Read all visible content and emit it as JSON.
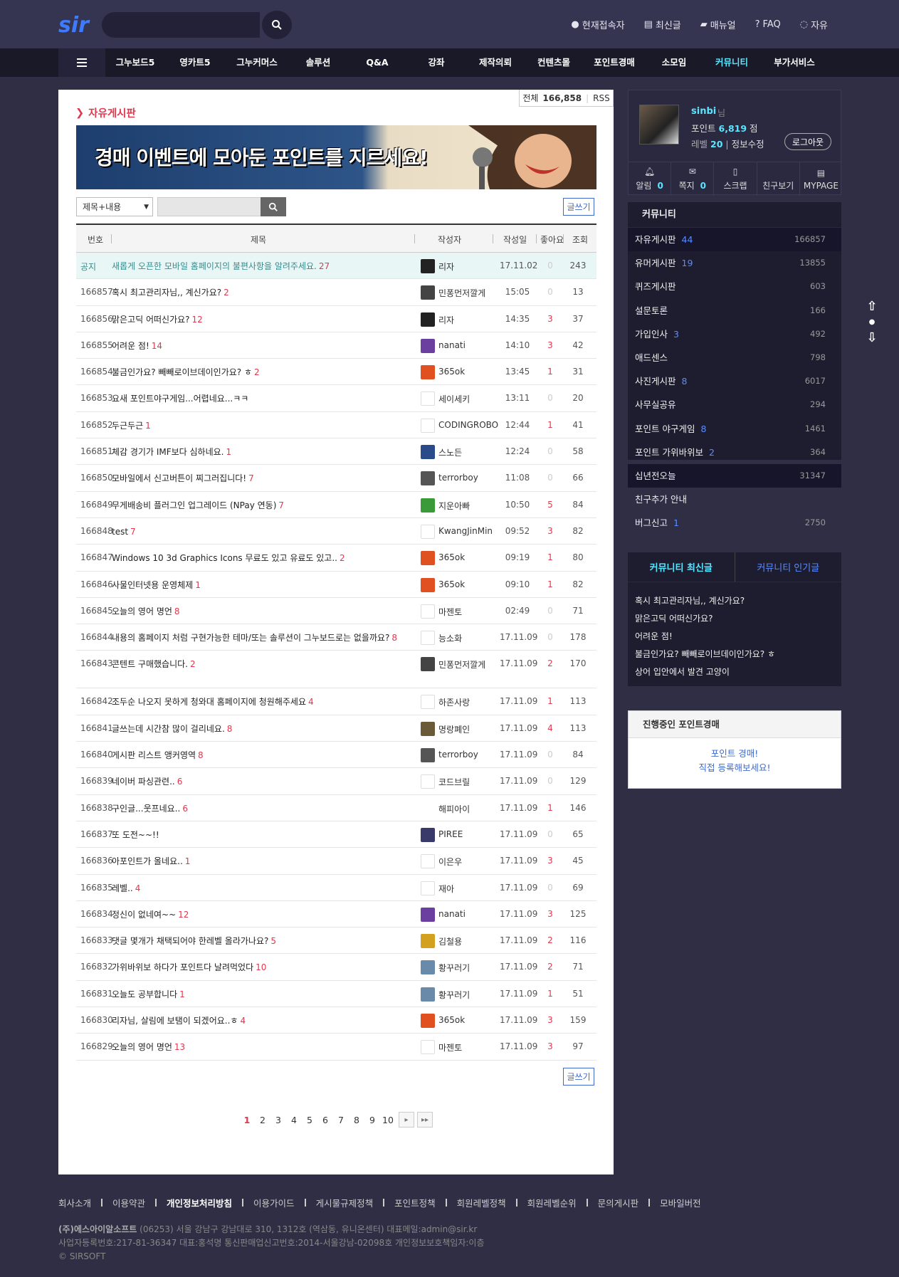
{
  "top_links": [
    "현재접속자",
    "최신글",
    "매뉴얼",
    "FAQ",
    "자유"
  ],
  "nav": [
    "그누보드5",
    "영카트5",
    "그누커머스",
    "솔루션",
    "Q&A",
    "강좌",
    "제작의뢰",
    "컨텐츠몰",
    "포인트경매",
    "소모임",
    "커뮤니티",
    "부가서비스"
  ],
  "board": {
    "total_label": "전체",
    "total": "166,858",
    "rss": "RSS",
    "title": "자유게시판",
    "banner_text": "경매 이벤트에 모아둔 포인트를 지르세요!",
    "search_field": "제목+내용",
    "write": "글쓰기"
  },
  "columns": {
    "num": "번호",
    "subject": "제목",
    "writer": "작성자",
    "date": "작성일",
    "good": "좋아요",
    "hit": "조회"
  },
  "rows": [
    {
      "num": "공지",
      "subject": "새롭게 오픈한 모바일 홈페이지의 불편사항을 알려주세요.",
      "cmt": "27",
      "name": "리자",
      "date": "17.11.02",
      "good": "0",
      "hit": "243"
    },
    {
      "num": "166857",
      "subject": "혹시 최고관리자님,, 계신가요?",
      "cmt": "2",
      "name": "민퐁먼저깔게",
      "date": "15:05",
      "good": "0",
      "hit": "13"
    },
    {
      "num": "166856",
      "subject": "맑은고딕 어떠신가요?",
      "cmt": "12",
      "name": "리자",
      "date": "14:35",
      "good": "3",
      "hit": "37"
    },
    {
      "num": "166855",
      "subject": "어려운 점!",
      "cmt": "14",
      "name": "nanati",
      "date": "14:10",
      "good": "3",
      "hit": "42"
    },
    {
      "num": "166854",
      "subject": "불금인가요? 빼빼로이브데이인가요? ㅎ",
      "cmt": "2",
      "name": "365ok",
      "date": "13:45",
      "good": "1",
      "hit": "31"
    },
    {
      "num": "166853",
      "subject": "요새 포인트야구게임...어렵네요...ㅋㅋ",
      "cmt": "",
      "name": "세이세키",
      "date": "13:11",
      "good": "0",
      "hit": "20"
    },
    {
      "num": "166852",
      "subject": "두근두근",
      "cmt": "1",
      "name": "CODINGROBO",
      "date": "12:44",
      "good": "1",
      "hit": "41"
    },
    {
      "num": "166851",
      "subject": "체감 경기가 IMF보다 심하네요.",
      "cmt": "1",
      "name": "스노든",
      "date": "12:24",
      "good": "0",
      "hit": "58"
    },
    {
      "num": "166850",
      "subject": "모바일에서 신고버튼이 찌그러집니다!",
      "cmt": "7",
      "name": "terrorboy",
      "date": "11:08",
      "good": "0",
      "hit": "66"
    },
    {
      "num": "166849",
      "subject": "무게배송비 플러그인 업그레이드 (NPay 연동)",
      "cmt": "7",
      "name": "지운아빠",
      "date": "10:50",
      "good": "5",
      "hit": "84"
    },
    {
      "num": "166848",
      "subject": "test",
      "cmt": "7",
      "name": "KwangJinMin",
      "date": "09:52",
      "good": "3",
      "hit": "82"
    },
    {
      "num": "166847",
      "subject": "Windows 10 3d Graphics Icons 무료도 있고 유료도 있고..",
      "cmt": "2",
      "name": "365ok",
      "date": "09:19",
      "good": "1",
      "hit": "80"
    },
    {
      "num": "166846",
      "subject": "사물인터넷용 운영체제",
      "cmt": "1",
      "name": "365ok",
      "date": "09:10",
      "good": "1",
      "hit": "82"
    },
    {
      "num": "166845",
      "subject": "오늘의 영어 명언",
      "cmt": "8",
      "name": "마젠토",
      "date": "02:49",
      "good": "0",
      "hit": "71"
    },
    {
      "num": "166844",
      "subject": "내용의 홈페이지 처럼 구현가능한 테마/또는 솔루션이 그누보드로는 없을까요?",
      "cmt": "8",
      "name": "능소화",
      "date": "17.11.09",
      "good": "0",
      "hit": "178"
    },
    {
      "num": "166843",
      "subject": "콘텐트 구매했습니다.",
      "cmt": "2",
      "name": "민퐁먼저깔게",
      "date": "17.11.09",
      "good": "2",
      "hit": "170"
    },
    {
      "num": "166842",
      "subject": "조두순 나오지 못하게 청와대 홈페이지에 청원해주세요",
      "cmt": "4",
      "name": "하존사랑",
      "date": "17.11.09",
      "good": "1",
      "hit": "113"
    },
    {
      "num": "166841",
      "subject": "글쓰는데 시간참 많이 걸리네요.",
      "cmt": "8",
      "name": "명랑폐인",
      "date": "17.11.09",
      "good": "4",
      "hit": "113"
    },
    {
      "num": "166840",
      "subject": "게시판 리스트 앵커영역",
      "cmt": "8",
      "name": "terrorboy",
      "date": "17.11.09",
      "good": "0",
      "hit": "84"
    },
    {
      "num": "166839",
      "subject": "네이버 파싱관련..",
      "cmt": "6",
      "name": "코드브릴",
      "date": "17.11.09",
      "good": "0",
      "hit": "129"
    },
    {
      "num": "166838",
      "subject": "구인글...웃프네요..",
      "cmt": "6",
      "name": "해피아이",
      "date": "17.11.09",
      "good": "1",
      "hit": "146"
    },
    {
      "num": "166837",
      "subject": "또 도전~~!!",
      "cmt": "",
      "name": "PIREE",
      "date": "17.11.09",
      "good": "0",
      "hit": "65"
    },
    {
      "num": "166836",
      "subject": "아포인트가 올네요..",
      "cmt": "1",
      "name": "이은우",
      "date": "17.11.09",
      "good": "3",
      "hit": "45"
    },
    {
      "num": "166835",
      "subject": "레벨..",
      "cmt": "4",
      "name": "재아",
      "date": "17.11.09",
      "good": "0",
      "hit": "69"
    },
    {
      "num": "166834",
      "subject": "정신이 없네여~~",
      "cmt": "12",
      "name": "nanati",
      "date": "17.11.09",
      "good": "3",
      "hit": "125"
    },
    {
      "num": "166833",
      "subject": "댓글 몇개가 채택되어야 한레벨 올라가나요?",
      "cmt": "5",
      "name": "김철용",
      "date": "17.11.09",
      "good": "2",
      "hit": "116"
    },
    {
      "num": "166832",
      "subject": "가위바위보 하다가 포인트다 날려먹었다",
      "cmt": "10",
      "name": "황꾸러기",
      "date": "17.11.09",
      "good": "2",
      "hit": "71"
    },
    {
      "num": "166831",
      "subject": "오늘도 공부합니다",
      "cmt": "1",
      "name": "황꾸러기",
      "date": "17.11.09",
      "good": "1",
      "hit": "51"
    },
    {
      "num": "166830",
      "subject": "리자님, 살림에 보탬이 되겠어요..ㅎ",
      "cmt": "4",
      "name": "365ok",
      "date": "17.11.09",
      "good": "3",
      "hit": "159"
    },
    {
      "num": "166829",
      "subject": "오늘의 영어 명언",
      "cmt": "13",
      "name": "마젠토",
      "date": "17.11.09",
      "good": "3",
      "hit": "97"
    }
  ],
  "pages": [
    "1",
    "2",
    "3",
    "4",
    "5",
    "6",
    "7",
    "8",
    "9",
    "10"
  ],
  "profile": {
    "name": "sinbi",
    "name_suffix": "님",
    "point_label": "포인트",
    "point": "6,819",
    "point_unit": "점",
    "level_label": "레벨",
    "level": "20",
    "edit": "정보수정",
    "logout": "로그아웃"
  },
  "profile_icons": [
    {
      "label": "알림",
      "count": "0"
    },
    {
      "label": "쪽지",
      "count": "0"
    },
    {
      "label": "스크랩",
      "count": ""
    },
    {
      "label": "친구보기",
      "count": ""
    },
    {
      "label": "MYPAGE",
      "count": ""
    }
  ],
  "community": {
    "title": "커뮤니티",
    "items": [
      {
        "label": "자유게시판",
        "new": "44",
        "total": "166857"
      },
      {
        "label": "유머게시판",
        "new": "19",
        "total": "13855"
      },
      {
        "label": "퀴즈게시판",
        "new": "",
        "total": "603"
      },
      {
        "label": "설문토론",
        "new": "",
        "total": "166"
      },
      {
        "label": "가입인사",
        "new": "3",
        "total": "492"
      },
      {
        "label": "애드센스",
        "new": "",
        "total": "798"
      },
      {
        "label": "사진게시판",
        "new": "8",
        "total": "6017"
      },
      {
        "label": "사무실공유",
        "new": "",
        "total": "294"
      },
      {
        "label": "포인트 야구게임",
        "new": "8",
        "total": "1461"
      },
      {
        "label": "포인트 가위바위보",
        "new": "2",
        "total": "364"
      },
      {
        "label": "십년전오늘",
        "new": "",
        "total": "31347"
      },
      {
        "label": "친구추가 안내",
        "new": "",
        "total": ""
      },
      {
        "label": "버그신고",
        "new": "1",
        "total": "2750"
      }
    ]
  },
  "latest": {
    "tab1": "커뮤니티 최신글",
    "tab2": "커뮤니티 인기글",
    "items": [
      "혹시 최고관리자님,, 계신가요?",
      "맑은고딕 어떠신가요?",
      "어려운 점!",
      "불금인가요? 빼빼로이브데이인가요? ㅎ",
      "상어 입안에서 발견 고양이"
    ]
  },
  "auction": {
    "title": "진행중인 포인트경매",
    "line1": "포인트 경매!",
    "line2": "직접 등록해보세요!"
  },
  "footer": {
    "links": [
      "회사소개",
      "이용약관",
      "개인정보처리방침",
      "이용가이드",
      "게시물규제정책",
      "포인트정책",
      "회원레벨정책",
      "회원레벨순위",
      "문의게시판",
      "모바일버전"
    ],
    "company": "(주)에스아이알소프트",
    "info1": "(06253) 서울 강남구 강남대로 310, 1312호 (역삼동, 유니온센터) 대표메일:admin@sir.kr",
    "info2": "사업자등록번호:217-81-36347 대표:홍석명 통신판매업신고번호:2014-서울강남-02098호 개인정보보호책임자:이층",
    "copy": "© SIRSOFT"
  },
  "colors": {
    "bg": "#2f2e45",
    "accent": "#5ce5ff",
    "red": "#e0384f",
    "blue": "#3f6acb"
  }
}
